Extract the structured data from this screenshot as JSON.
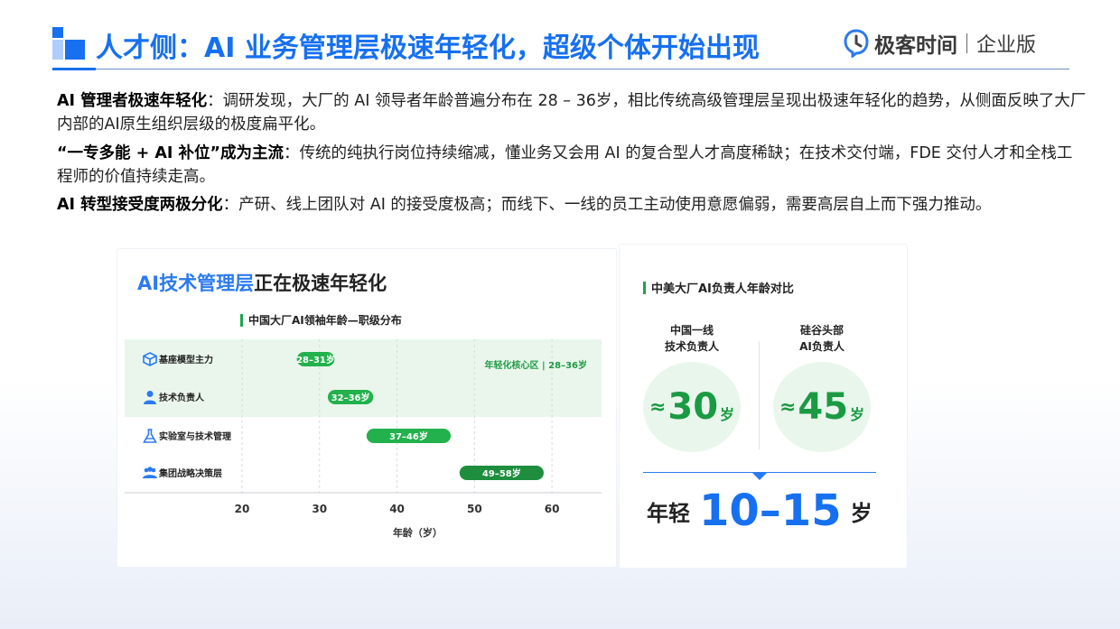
{
  "header": {
    "title": "人才侧：AI 业务管理层极速年轻化，超级个体开始出现",
    "brand_name": "极客时间",
    "brand_sub": "企业版",
    "accent_color": "#1670f0"
  },
  "paragraphs": [
    {
      "lead": "AI 管理者极速年轻化",
      "text": "：调研发现，大厂的 AI 领导者年龄普遍分布在 28 – 36岁，相比传统高级管理层呈现出极速年轻化的趋势，从侧面反映了大厂内部的AI原生组织层级的极度扁平化。"
    },
    {
      "lead": "“一专多能 + AI 补位”成为主流",
      "text": "：传统的纯执行岗位持续缩减，懂业务又会用 AI 的复合型人才高度稀缺；在技术交付端，FDE 交付人才和全栈工程师的价值持续走高。"
    },
    {
      "lead": "AI 转型接受度两极分化",
      "text": "：产研、线上团队对 AI 的接受度极高；而线下、一线的员工主动使用意愿偏弱，需要高层自上而下强力推动。"
    }
  ],
  "left_panel": {
    "title_blue": "AI技术管理层",
    "title_dark": "正在极速年轻化",
    "subheading": "中国大厂AI领袖年龄—职级分布"
  },
  "chart_data": {
    "type": "bar",
    "subtype": "range",
    "title": "中国大厂AI领袖年龄—职级分布",
    "xlabel": "年龄（岁）",
    "ylabel": "",
    "xlim": [
      20,
      65
    ],
    "xticks": [
      20,
      30,
      40,
      50,
      60
    ],
    "grid": true,
    "categories": [
      "基座模型主力",
      "技术负责人",
      "实验室与技术管理",
      "集团战略决策层"
    ],
    "icons": [
      "cube-icon",
      "person-icon",
      "flask-icon",
      "group-icon"
    ],
    "ranges": [
      {
        "start": 28,
        "end": 31,
        "label": "28–31岁",
        "color": "#22b14c"
      },
      {
        "start": 32,
        "end": 36,
        "label": "32–36岁",
        "color": "#22b14c"
      },
      {
        "start": 37,
        "end": 46,
        "label": "37–46岁",
        "color": "#22b14c"
      },
      {
        "start": 49,
        "end": 58,
        "label": "49–58岁",
        "color": "#1e8e3e"
      }
    ],
    "highlight_band": {
      "rows": [
        0,
        1
      ],
      "label": "年轻化核心区 | 28–36岁",
      "color": "#eaf6ec"
    }
  },
  "right_panel": {
    "subheading": "中美大厂AI负责人年龄对比",
    "cn_label_line1": "中国一线",
    "cn_label_line2": "技术负责人",
    "us_label_line1": "硅谷头部",
    "us_label_line2": "AI负责人",
    "approx": "≈",
    "cn_value": "30",
    "us_value": "45",
    "unit": "岁",
    "younger_prefix": "年轻",
    "younger_range": "10–15",
    "younger_unit": "岁"
  }
}
